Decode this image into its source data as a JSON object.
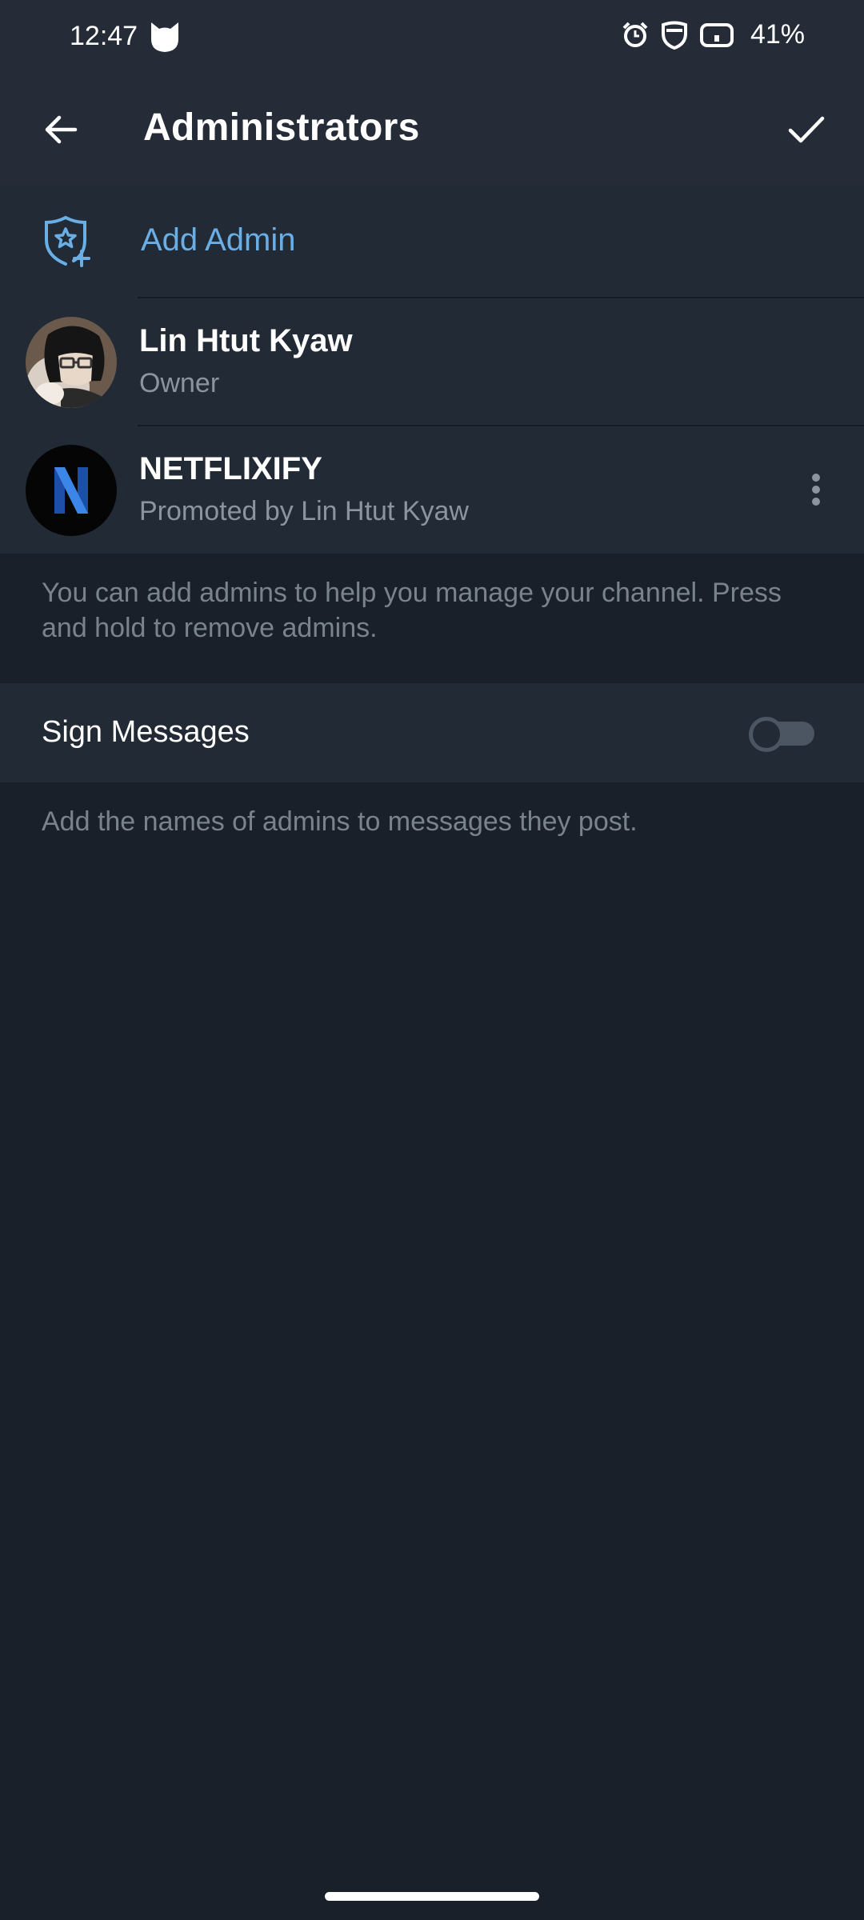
{
  "status_bar": {
    "time": "12:47",
    "battery": "41%",
    "icons": [
      "cat-icon",
      "alarm-icon",
      "shield-icon",
      "battery-icon"
    ]
  },
  "app_bar": {
    "title": "Administrators",
    "back_icon": "arrow-left-icon",
    "confirm_icon": "check-icon"
  },
  "add_admin": {
    "label": "Add Admin",
    "icon": "shield-star-plus-icon",
    "color": "#6aaee6"
  },
  "admins": [
    {
      "name": "Lin Htut Kyaw",
      "role": "Owner",
      "avatar": "anime-avatar"
    },
    {
      "name": "NETFLIXIFY",
      "role": "Promoted by Lin Htut Kyaw",
      "avatar": "netflix-n-logo"
    }
  ],
  "admins_info": "You can add admins to help you manage your channel. Press and hold to remove admins.",
  "sign_messages": {
    "label": "Sign Messages",
    "enabled": false,
    "info": "Add the names of admins to messages they post."
  },
  "colors": {
    "background": "#19202a",
    "surface": "#222a35",
    "header": "#252c38",
    "accent": "#6aaee6"
  }
}
